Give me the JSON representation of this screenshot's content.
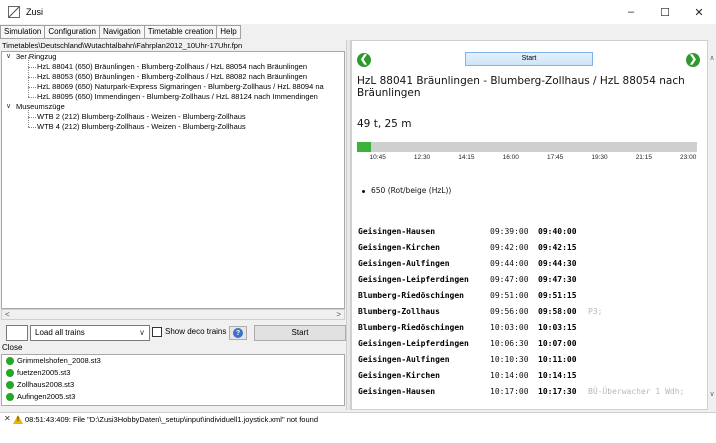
{
  "window": {
    "title": "Zusi",
    "minimize_glyph": "–",
    "maximize_glyph": "☐",
    "close_glyph": "✕"
  },
  "menu": [
    "Simulation",
    "Configuration",
    "Navigation",
    "Timetable creation",
    "Help"
  ],
  "filepath": "Timetables\\Deutschland\\Wutachtalbahn\\Fahrplan2012_10Uhr-17Uhr.fpn",
  "tree": {
    "groups": [
      {
        "label": "3er Ringzug",
        "items": [
          "HzL 88041  (650)  Bräunlingen - Blumberg-Zollhaus / HzL 88054 nach Bräunlingen",
          "HzL 88053  (650)  Bräunlingen - Blumberg-Zollhaus / HzL 88082 nach Bräunlingen",
          "HzL 88069  (650)  Naturpark-Express Sigmaringen - Blumberg-Zollhaus / HzL 88094 na",
          "HzL 88095  (650)  Immendingen - Blumberg-Zollhaus / HzL 88124 nach Immendingen"
        ]
      },
      {
        "label": "Museumszüge",
        "items": [
          "WTB 2  (212)  Blumberg-Zollhaus - Weizen - Blumberg-Zollhaus",
          "WTB 4  (212)  Blumberg-Zollhaus - Weizen - Blumberg-Zollhaus"
        ]
      }
    ],
    "expand_glyph": "∨"
  },
  "controls": {
    "load_select_value": "Load all trains",
    "show_deco_label": "Show deco trains",
    "help_glyph": "?",
    "start_label": "Start",
    "close_label": "Close"
  },
  "files": [
    "Grimmelshofen_2008.st3",
    "fuetzen2005.st3",
    "Zollhaus2008.st3",
    "Aufingen2005.st3"
  ],
  "detail": {
    "start_label": "Start",
    "prev_glyph": "❮",
    "next_glyph": "❯",
    "train_title": "HzL 88041 Bräunlingen - Blumberg-Zollhaus / HzL 88054 nach Bräunlingen",
    "weight_length": "49 t, 25 m",
    "timeline": {
      "progress": 0.04,
      "ticks": [
        "10:45",
        "12:30",
        "14:15",
        "16:00",
        "17:45",
        "19:30",
        "21:15",
        "23:00"
      ]
    },
    "vehicles": [
      "650 (Rot/beige (HzL))"
    ],
    "stops": [
      {
        "name": "Geisingen-Hausen",
        "arr": "09:39:00",
        "dep": "09:40:00",
        "note": ""
      },
      {
        "name": "Geisingen-Kirchen",
        "arr": "09:42:00",
        "dep": "09:42:15",
        "note": ""
      },
      {
        "name": "Geisingen-Aulfingen",
        "arr": "09:44:00",
        "dep": "09:44:30",
        "note": ""
      },
      {
        "name": "Geisingen-Leipferdingen",
        "arr": "09:47:00",
        "dep": "09:47:30",
        "note": ""
      },
      {
        "name": "Blumberg-Riedöschingen",
        "arr": "09:51:00",
        "dep": "09:51:15",
        "note": ""
      },
      {
        "name": "Blumberg-Zollhaus",
        "arr": "09:56:00",
        "dep": "09:58:00",
        "note": "P3;"
      },
      {
        "name": "Blumberg-Riedöschingen",
        "arr": "10:03:00",
        "dep": "10:03:15",
        "note": ""
      },
      {
        "name": "Geisingen-Leipferdingen",
        "arr": "10:06:30",
        "dep": "10:07:00",
        "note": ""
      },
      {
        "name": "Geisingen-Aulfingen",
        "arr": "10:10:30",
        "dep": "10:11:00",
        "note": ""
      },
      {
        "name": "Geisingen-Kirchen",
        "arr": "10:14:00",
        "dep": "10:14:15",
        "note": ""
      },
      {
        "name": "Geisingen-Hausen",
        "arr": "10:17:00",
        "dep": "10:17:30",
        "note": "BÜ-Überwacher 1 Wdh;"
      }
    ]
  },
  "status": {
    "close_glyph": "✕",
    "warning_glyph": "!",
    "message": "08:51:43:409: File \"D:\\Zusi3HobbyDaten\\_setup\\input\\individuell1.joystick.xml\" not found"
  },
  "colors": {
    "accent_green": "#2e9a2e",
    "progress_green": "#3bb33b",
    "note_gray": "#b8b8b8",
    "file_dot_green": "#26a826"
  }
}
